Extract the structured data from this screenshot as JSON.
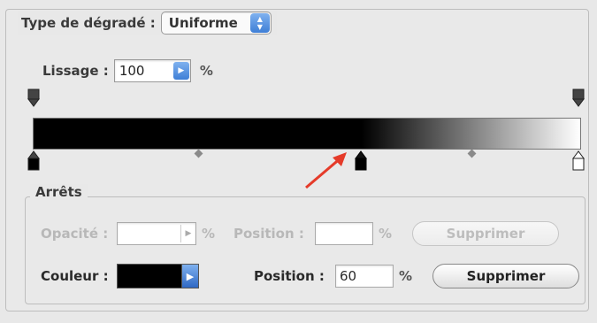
{
  "gradient_type": {
    "label": "Type de dégradé :",
    "value": "Uniforme"
  },
  "smoothness": {
    "label": "Lissage :",
    "value": "100",
    "unit": "%"
  },
  "gradient": {
    "stop_color_position_percent": 60,
    "start_color": "#000000",
    "end_color": "#ffffff"
  },
  "stops": {
    "legend": "Arrêts",
    "opacity": {
      "label": "Opacité :",
      "value": "",
      "unit": "%"
    },
    "opacity_position": {
      "label": "Position :",
      "value": "",
      "unit": "%"
    },
    "opacity_delete": "Supprimer",
    "color": {
      "label": "Couleur :",
      "value": "#000000"
    },
    "color_position": {
      "label": "Position :",
      "value": "60",
      "unit": "%"
    },
    "color_delete": "Supprimer"
  },
  "icons": {
    "select_arrows": "up-down-arrows-icon",
    "stepper": "play-right-icon",
    "annotation": "red-arrow-icon"
  }
}
